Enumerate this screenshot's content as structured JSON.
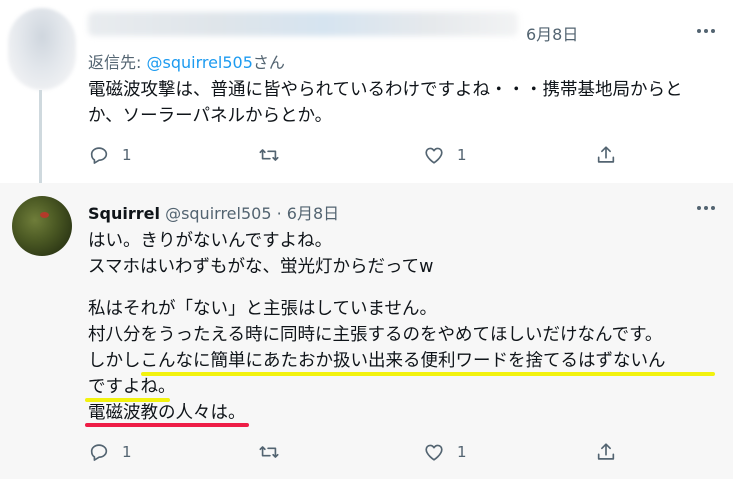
{
  "tweet1": {
    "date": "6月8日",
    "reply_prefix": "返信先: ",
    "reply_mention": "@squirrel505",
    "reply_suffix": "さん",
    "text_lines": [
      "電磁波攻撃は、普通に皆やられているわけですよね・・・携帯基地局からと",
      "か、ソーラーパネルからとか。"
    ],
    "reply_count": "1",
    "like_count": "1"
  },
  "tweet2": {
    "display_name": "Squirrel",
    "handle": "@squirrel505",
    "separator": "·",
    "date": "6月8日",
    "text_lines": [
      "はい。きりがないんですよね。",
      "スマホはいわずもがな、蛍光灯からだってw",
      "私はそれが「ない」と主張はしていません。",
      "村八分をうったえる時に同時に主張するのをやめてほしいだけなんです。",
      "しかしこんなに簡単にあたおか扱い出来る便利ワードを捨てるはずないん",
      "ですよね。",
      "電磁波教の人々は。"
    ],
    "reply_count": "1",
    "like_count": "1"
  },
  "colors": {
    "highlight_yellow": "#f2f20e",
    "highlight_red": "#ee1d46",
    "mention_blue": "#1d9bf0",
    "secondary_text": "#536471"
  },
  "icons": [
    "more-icon",
    "reply-icon",
    "retweet-icon",
    "like-icon",
    "share-icon"
  ]
}
